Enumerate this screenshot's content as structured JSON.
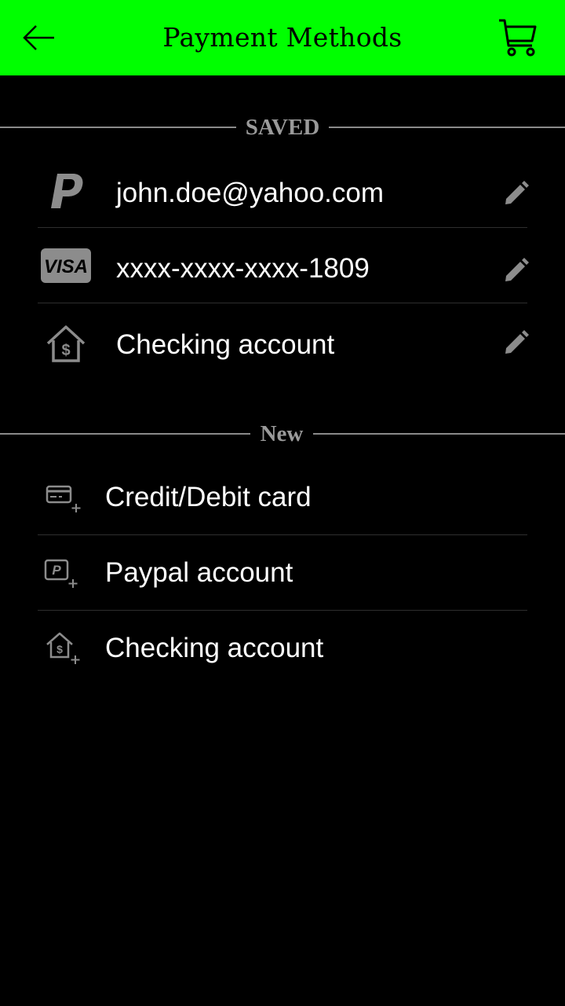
{
  "header": {
    "title": "Payment Methods",
    "background": "#00ff00",
    "back_icon": "arrow-left-icon",
    "cart_icon": "shopping-cart-icon"
  },
  "saved_section": {
    "label": "SAVED",
    "items": [
      {
        "icon": "paypal-icon",
        "label": "john.doe@yahoo.com",
        "action_icon": "pencil-edit-icon"
      },
      {
        "icon": "visa-icon",
        "icon_text": "VISA",
        "label": "xxxx-xxxx-xxxx-1809",
        "action_icon": "pencil-edit-icon"
      },
      {
        "icon": "bank-house-dollar-icon",
        "label": "Checking account",
        "action_icon": "pencil-edit-icon"
      }
    ]
  },
  "new_section": {
    "label": "New",
    "items": [
      {
        "icon": "card-add-icon",
        "label": "Credit/Debit card"
      },
      {
        "icon": "paypal-add-icon",
        "label": "Paypal account"
      },
      {
        "icon": "bank-add-icon",
        "label": "Checking account"
      }
    ]
  },
  "colors": {
    "accent": "#00ff00",
    "background": "#000000",
    "text": "#ffffff",
    "muted": "#9a9a9a"
  }
}
